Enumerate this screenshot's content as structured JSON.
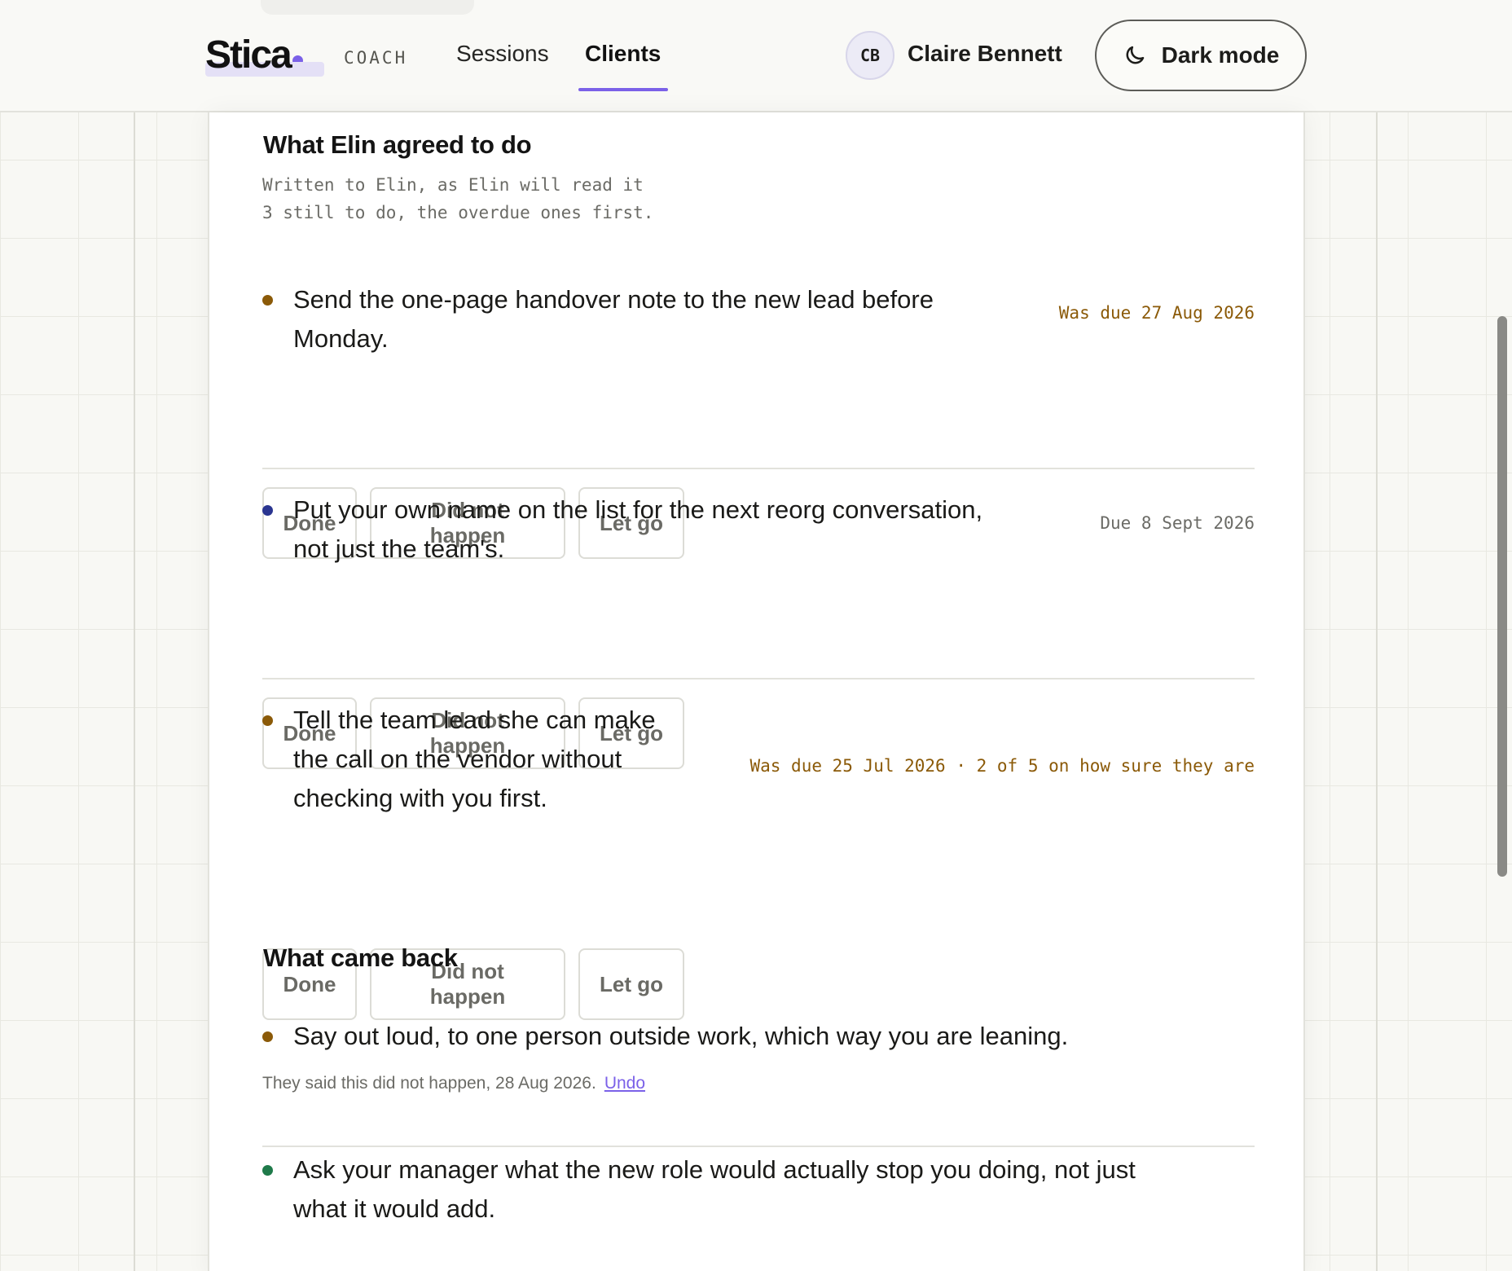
{
  "header": {
    "logo": "Stica",
    "role": "COACH",
    "nav": [
      {
        "label": "Sessions",
        "active": false
      },
      {
        "label": "Clients",
        "active": true
      }
    ],
    "user": {
      "initials": "CB",
      "name": "Claire Bennett"
    },
    "dark_mode_label": "Dark mode"
  },
  "colors": {
    "accent": "#7b61e8",
    "overdue": "#8b5a08",
    "bullet_brown": "#8b5a08",
    "bullet_navy": "#2a3590",
    "bullet_green": "#1f7a4a"
  },
  "agreed": {
    "title": "What Elin agreed to do",
    "note_line1": "Written to Elin, as Elin will read it",
    "note_line2": "3 still to do, the overdue ones first.",
    "actions": {
      "done": "Done",
      "did_not_happen": "Did not happen",
      "let_go": "Let go"
    },
    "items": [
      {
        "line1": "Send the one-page handover note to the new lead before",
        "line2": "Monday.",
        "due": "Was due 27 Aug 2026",
        "status": "overdue",
        "bullet": "brown"
      },
      {
        "line1": "Put your own name on the list for the next reorg conversation,",
        "line2": "not just the team's.",
        "due": "Due 8 Sept 2026",
        "status": "upcoming",
        "bullet": "navy"
      },
      {
        "line1": "Tell the team lead she can make",
        "line2": "the call on the vendor without",
        "line3": "checking with you first.",
        "due": "Was due 25 Jul 2026 · 2 of 5 on how sure they are",
        "status": "overdue",
        "bullet": "brown"
      }
    ]
  },
  "came_back": {
    "title": "What came back",
    "items": [
      {
        "text": "Say out loud, to one person outside work, which way you are leaning.",
        "note": "They said this did not happen, 28 Aug 2026.",
        "undo": "Undo",
        "bullet": "brown"
      },
      {
        "line1": "Ask your manager what the new role would actually stop you doing, not just",
        "line2": "what it would add.",
        "bullet": "green"
      }
    ]
  }
}
